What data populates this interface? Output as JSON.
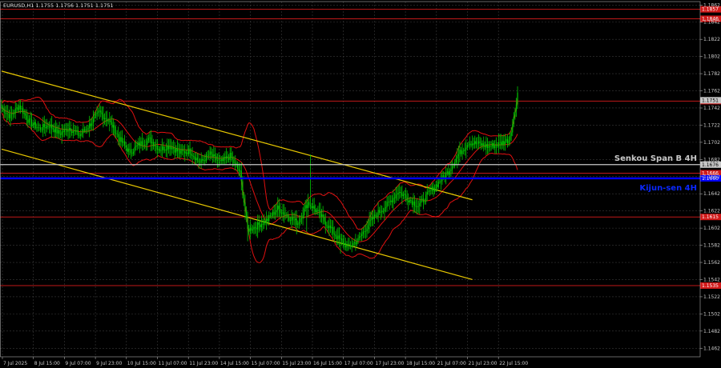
{
  "chart_data": {
    "type": "candlestick",
    "symbol_header": "EURUSD,H1  1.1755 1.1756 1.1751 1.1751",
    "x_tick_labels": [
      "7 Jul 2025",
      "8 Jul 15:00",
      "9 Jul 07:00",
      "9 Jul 23:00",
      "10 Jul 15:00",
      "11 Jul 07:00",
      "11 Jul 23:00",
      "14 Jul 15:00",
      "15 Jul 07:00",
      "15 Jul 23:00",
      "16 Jul 15:00",
      "17 Jul 07:00",
      "17 Jul 23:00",
      "18 Jul 15:00",
      "21 Jul 07:00",
      "21 Jul 23:00",
      "22 Jul 15:00"
    ],
    "y_tick_labels": [
      "1.1862",
      "1.1842",
      "1.1822",
      "1.1802",
      "1.1782",
      "1.1762",
      "1.1742",
      "1.1722",
      "1.1702",
      "1.1682",
      "1.1662",
      "1.1642",
      "1.1622",
      "1.1602",
      "1.1582",
      "1.1562",
      "1.1542",
      "1.1522",
      "1.1502",
      "1.1482",
      "1.1462"
    ],
    "ylim": [
      1.1452,
      1.1866
    ],
    "grid": true,
    "colors": {
      "background": "#000000",
      "grid": "#3a3a3a",
      "candle_up": "#00c800",
      "candle_down": "#00c800",
      "channel": "#e8c800",
      "bollinger": "#e01010",
      "level_line": "#c01818",
      "level_box": "#d01818",
      "senkou": "#c8c8c8",
      "kijun": "#0000ff",
      "kijun_label": "#0a28ff",
      "current_price_box": "#c8c8c8"
    },
    "horizontal_levels": [
      {
        "price": 1.1857,
        "label": "1.1857",
        "color": "#c01818"
      },
      {
        "price": 1.1846,
        "label": "1.1846",
        "color": "#c01818"
      },
      {
        "price": 1.175,
        "label": "1.1750",
        "color": "#c01818"
      },
      {
        "price": 1.1666,
        "label": "1.1666",
        "color": "#c01818"
      },
      {
        "price": 1.1615,
        "label": "1.1615",
        "color": "#c01818"
      },
      {
        "price": 1.1535,
        "label": "1.1535",
        "color": "#c01818"
      }
    ],
    "senkou_span_b": {
      "price": 1.1676,
      "label": "Senkou Span B 4H",
      "value_label": "1.1676"
    },
    "kijun_sen": {
      "price": 1.166,
      "label": "Kijun-sen 4H",
      "value_label": "1.1660"
    },
    "current_price": {
      "price": 1.1751,
      "label": "1.1751"
    },
    "price_path": [
      [
        0,
        1.1742
      ],
      [
        7,
        1.1732
      ],
      [
        14,
        1.1745
      ],
      [
        22,
        1.1726
      ],
      [
        30,
        1.1718
      ],
      [
        38,
        1.1722
      ],
      [
        46,
        1.1712
      ],
      [
        54,
        1.1719
      ],
      [
        62,
        1.171
      ],
      [
        70,
        1.1722
      ],
      [
        78,
        1.1737
      ],
      [
        86,
        1.1726
      ],
      [
        94,
        1.1706
      ],
      [
        102,
        1.169
      ],
      [
        110,
        1.17
      ],
      [
        118,
        1.1705
      ],
      [
        126,
        1.1694
      ],
      [
        134,
        1.1698
      ],
      [
        142,
        1.169
      ],
      [
        150,
        1.1692
      ],
      [
        158,
        1.1678
      ],
      [
        166,
        1.1688
      ],
      [
        174,
        1.1678
      ],
      [
        182,
        1.1686
      ],
      [
        190,
        1.1666
      ],
      [
        196,
        1.16
      ],
      [
        204,
        1.1605
      ],
      [
        212,
        1.1612
      ],
      [
        220,
        1.1625
      ],
      [
        228,
        1.1616
      ],
      [
        236,
        1.1608
      ],
      [
        244,
        1.1632
      ],
      [
        252,
        1.162
      ],
      [
        260,
        1.1605
      ],
      [
        268,
        1.159
      ],
      [
        276,
        1.158
      ],
      [
        284,
        1.1588
      ],
      [
        292,
        1.1606
      ],
      [
        300,
        1.162
      ],
      [
        308,
        1.163
      ],
      [
        316,
        1.1645
      ],
      [
        324,
        1.1636
      ],
      [
        332,
        1.1628
      ],
      [
        340,
        1.1642
      ],
      [
        348,
        1.1655
      ],
      [
        356,
        1.1668
      ],
      [
        364,
        1.1688
      ],
      [
        372,
        1.1702
      ],
      [
        380,
        1.17
      ],
      [
        388,
        1.1697
      ],
      [
        396,
        1.17
      ],
      [
        404,
        1.1705
      ],
      [
        408,
        1.173
      ],
      [
        411,
        1.176
      ]
    ],
    "descending_channel": [
      {
        "from": [
          0,
          1.1785
        ],
        "to": [
          375,
          1.1635
        ]
      },
      {
        "from": [
          0,
          1.1694
        ],
        "to": [
          375,
          1.1542
        ]
      }
    ]
  }
}
